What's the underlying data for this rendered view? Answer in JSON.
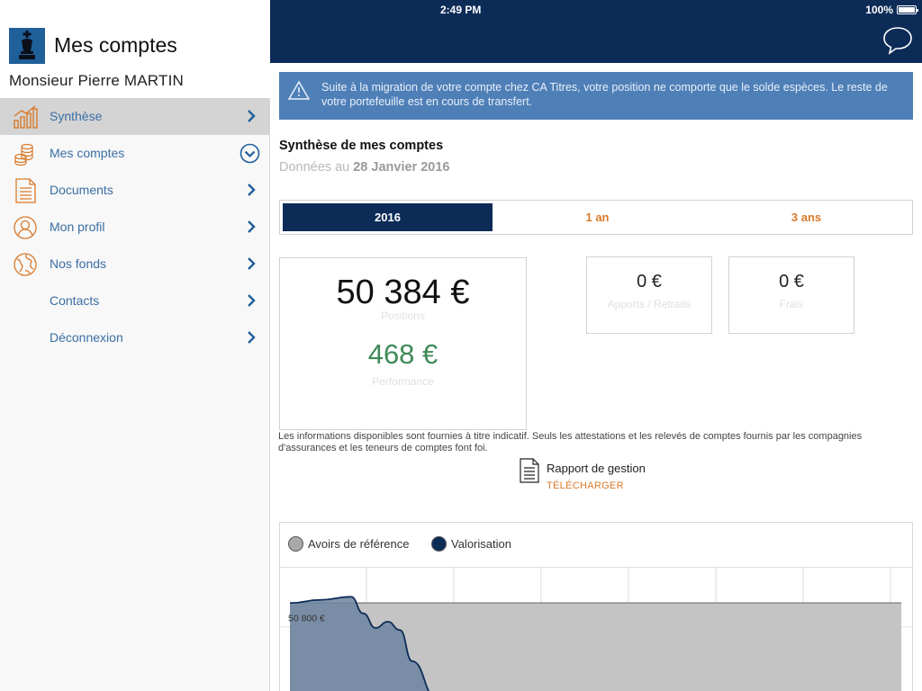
{
  "status_bar": {
    "time": "2:49 PM",
    "battery": "100%"
  },
  "sidebar": {
    "title": "Mes comptes",
    "user": "Monsieur Pierre MARTIN",
    "items": [
      {
        "label": "Synthèse",
        "icon": "chart-icon",
        "active": true
      },
      {
        "label": "Mes comptes",
        "icon": "coins-icon",
        "active": false
      },
      {
        "label": "Documents",
        "icon": "document-icon",
        "active": false
      },
      {
        "label": "Mon profil",
        "icon": "profile-icon",
        "active": false
      },
      {
        "label": "Nos fonds",
        "icon": "globe-icon",
        "active": false
      },
      {
        "label": "Contacts",
        "icon": "",
        "active": false
      },
      {
        "label": "Déconnexion",
        "icon": "",
        "active": false
      }
    ]
  },
  "alert": {
    "text": "Suite à la migration de votre compte chez CA Titres, votre position ne comporte que le solde espèces. Le reste de votre portefeuille est en cours de transfert."
  },
  "summary": {
    "title": "Synthèse de mes comptes",
    "date_prefix": "Données au",
    "date": "28 Janvier 2016"
  },
  "tabs": [
    {
      "label": "2016",
      "active": true
    },
    {
      "label": "1 an",
      "active": false
    },
    {
      "label": "3 ans",
      "active": false
    }
  ],
  "cards": {
    "positions_value": "50 384 €",
    "positions_label": "Positions",
    "performance_value": "468 €",
    "performance_label": "Performance",
    "apports_value": "0 €",
    "apports_label": "Apports / Retraits",
    "frais_value": "0 €",
    "frais_label": "Frais"
  },
  "disclaimer": "Les informations disponibles sont fournies à titre indicatif. Seuls les attestations et les relevés de comptes fournis par les compagnies d'assurances et les teneurs de comptes font foi.",
  "report": {
    "title": "Rapport de gestion",
    "link": "TÉLÉCHARGER"
  },
  "chart_data": {
    "type": "area",
    "legend": [
      {
        "name": "Avoirs de référence",
        "color": "#a9a9a9"
      },
      {
        "name": "Valorisation",
        "color": "#0c2b57"
      }
    ],
    "y_tick_labels": [
      "50 800 €"
    ],
    "series": [
      {
        "name": "Avoirs de référence",
        "x": [
          0,
          1
        ],
        "values": [
          50880,
          50880
        ]
      },
      {
        "name": "Valorisation",
        "x": [
          0,
          0.05,
          0.1,
          0.12,
          0.14,
          0.16,
          0.18,
          0.2,
          0.24
        ],
        "values": [
          50880,
          50895,
          50910,
          50830,
          50760,
          50790,
          50750,
          50600,
          50420
        ]
      }
    ]
  },
  "colors": {
    "navy": "#0c2b57",
    "accent_orange": "#d87a2a",
    "link_blue": "#3a6ea3",
    "alert_blue": "#4f7fb7",
    "performance_green": "#3f8a57"
  }
}
